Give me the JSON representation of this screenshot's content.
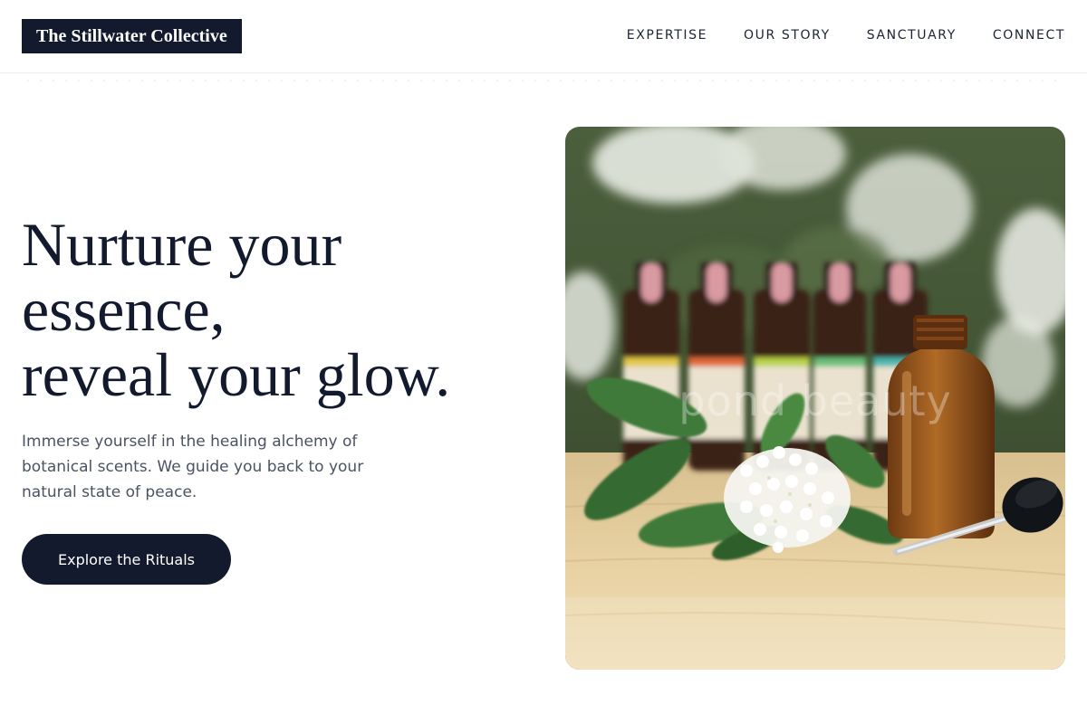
{
  "brand": {
    "name": "The Stillwater Collective"
  },
  "nav": {
    "items": [
      {
        "label": "EXPERTISE"
      },
      {
        "label": "OUR STORY"
      },
      {
        "label": "SANCTUARY"
      },
      {
        "label": "CONNECT"
      }
    ]
  },
  "hero": {
    "headline_lines": [
      "Nurture your",
      "essence,",
      "reveal your glow."
    ],
    "subtext": "Immerse yourself in the healing alchemy of botanical scents. We guide you back to your natural state of peace.",
    "cta_label": "Explore the Rituals",
    "image": {
      "watermark": "pond beauty"
    }
  },
  "colors": {
    "navy": "#131a2e",
    "body_text": "#4a5263",
    "background": "#ffffff"
  }
}
